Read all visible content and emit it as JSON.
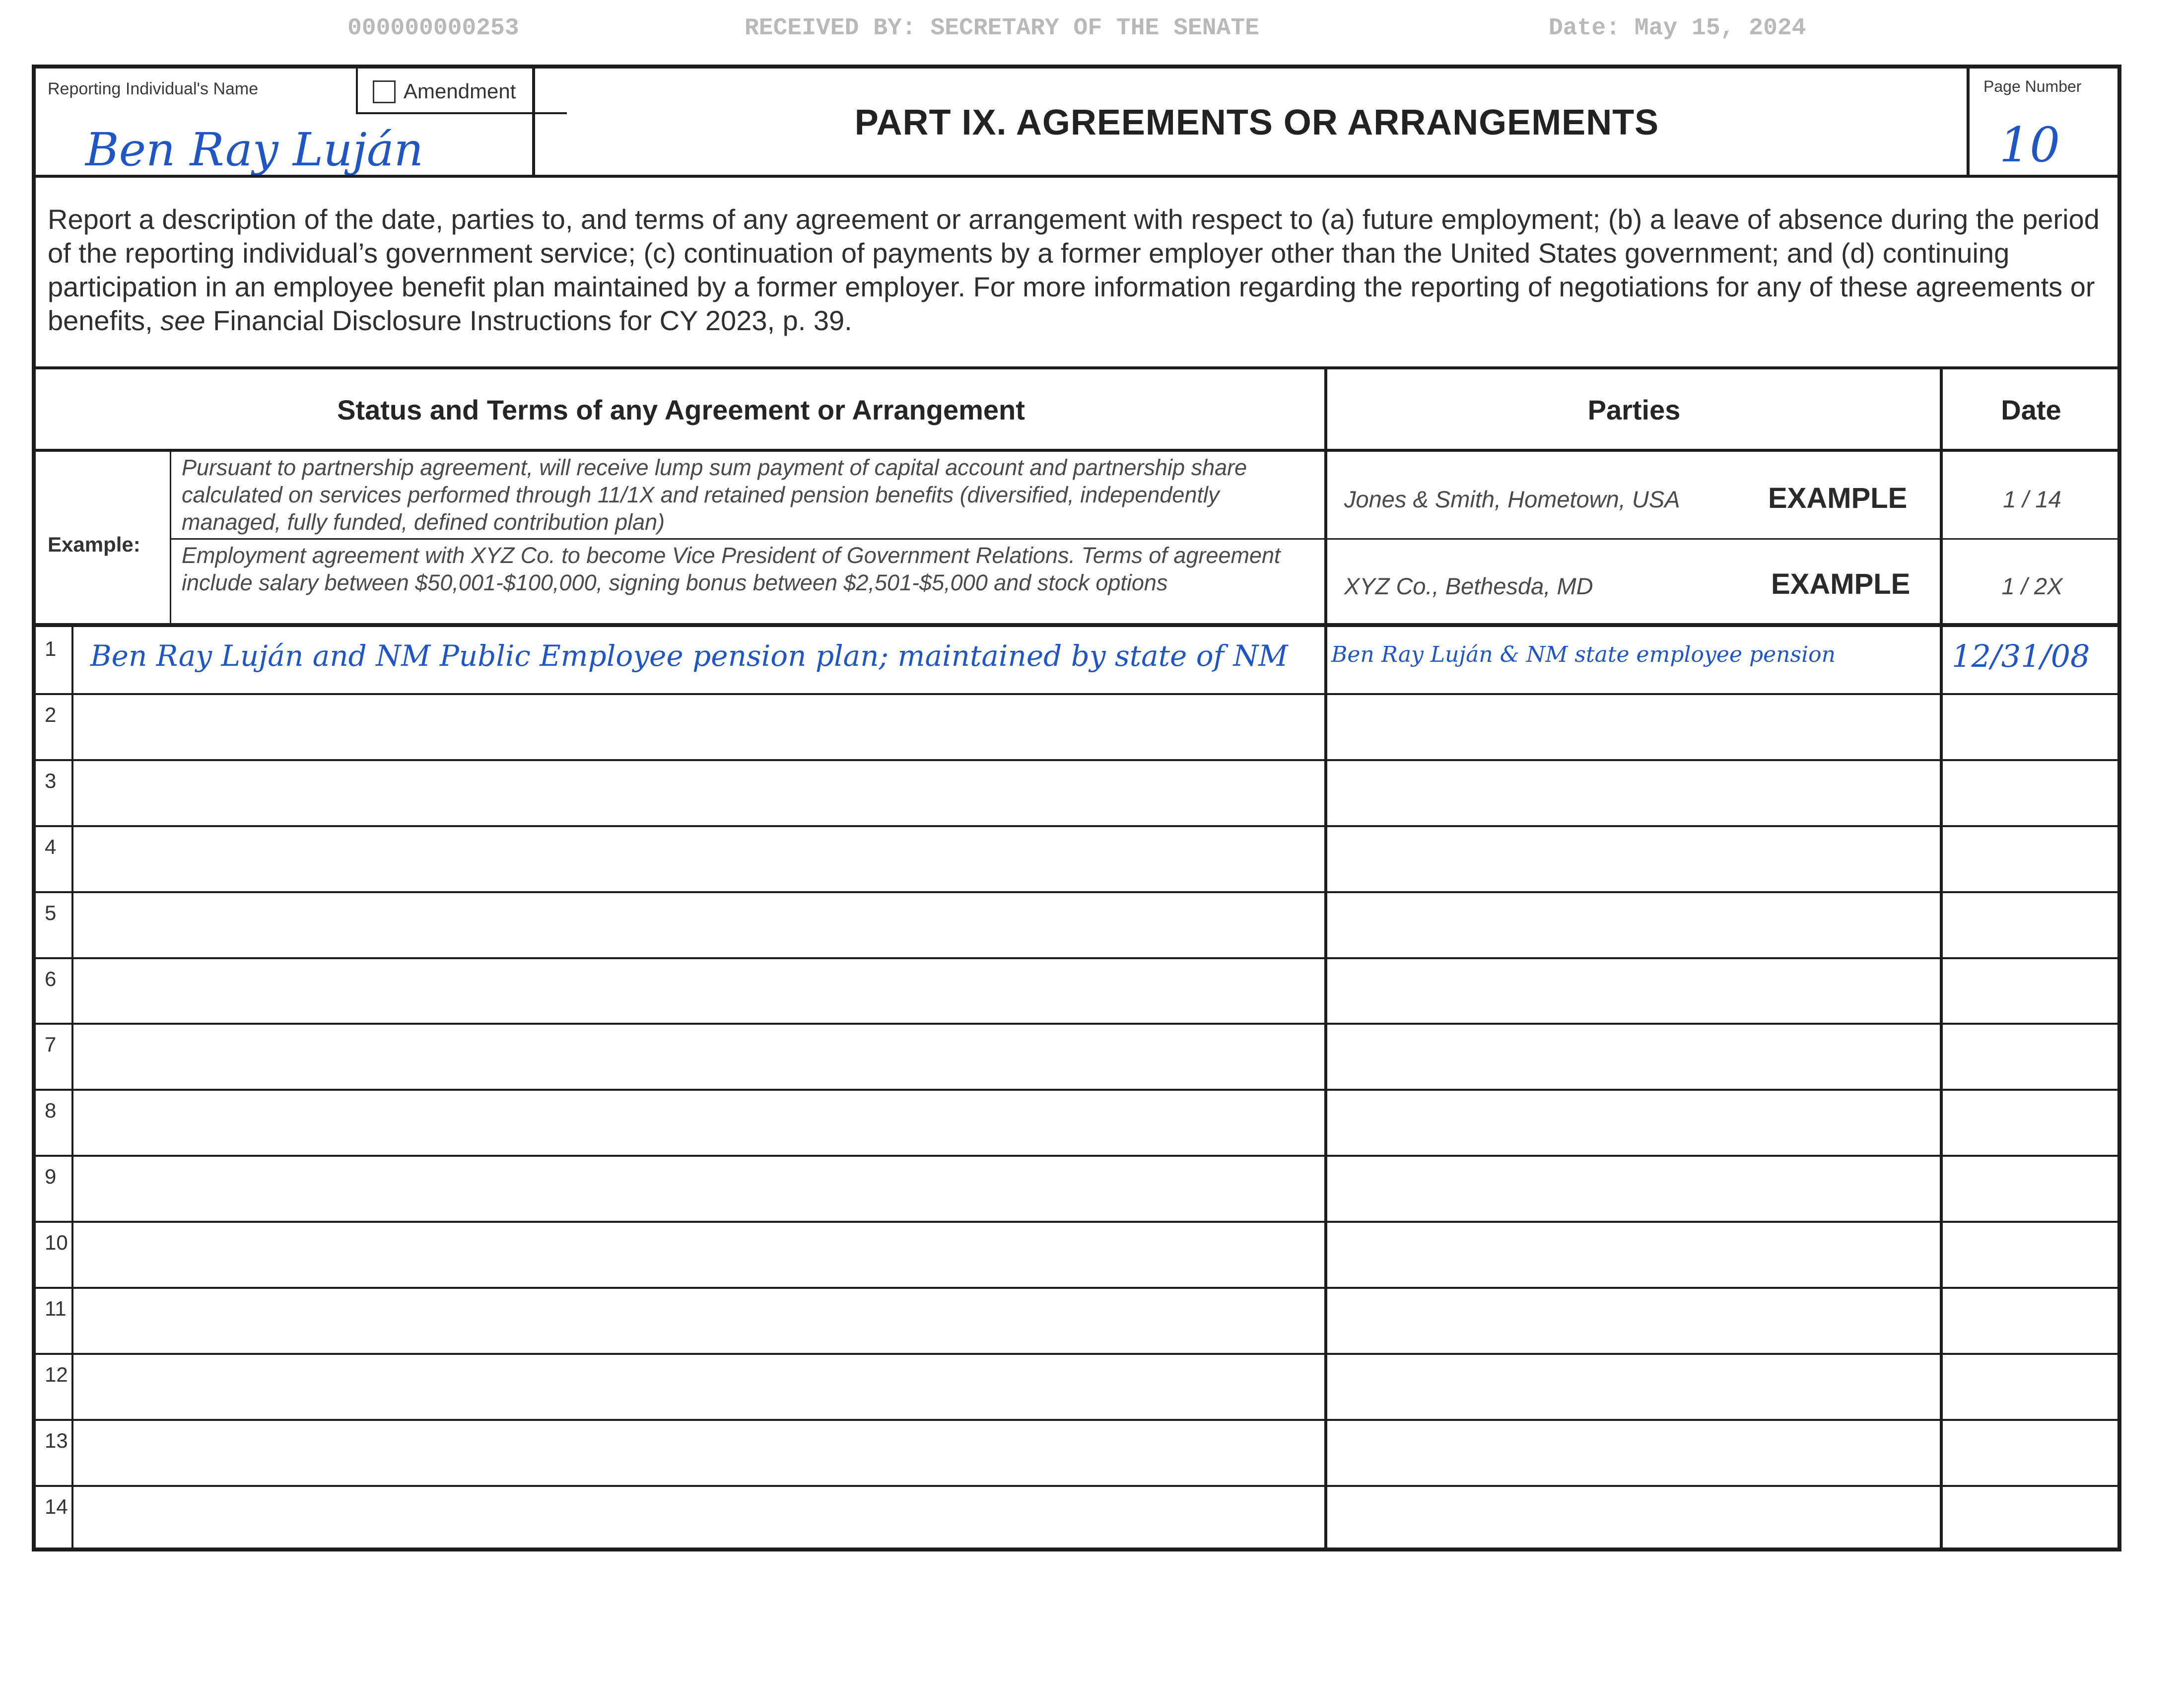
{
  "scan_header": {
    "doc_id": "000000000253",
    "received_by": "RECEIVED BY: SECRETARY OF THE SENATE",
    "date": "Date: May 15, 2024"
  },
  "form": {
    "reporting_name_label": "Reporting Individual's Name",
    "reporting_name_value": "Ben Ray Luján",
    "amendment_label": "Amendment",
    "title": "PART IX.   AGREEMENTS OR ARRANGEMENTS",
    "page_number_label": "Page Number",
    "page_number_value": "10",
    "instructions_pre": "Report a description of the date, parties to, and terms of any agreement or arrangement with respect to (a) future employment; (b) a leave of absence during the period of the reporting individual’s government service; (c) continuation of payments by a former employer other than the United States government; and (d) continuing participation in an employee benefit plan maintained by a former employer.  For more information regarding the reporting of negotiations for any of these agreements or benefits, ",
    "instructions_see": "see",
    "instructions_post": " Financial Disclosure Instructions for CY 2023, p. 39."
  },
  "table": {
    "headers": {
      "terms": "Status and Terms of any Agreement or Arrangement",
      "parties": "Parties",
      "date": "Date"
    },
    "example_label": "Example:",
    "examples": [
      {
        "terms": "Pursuant to partnership agreement, will receive lump sum payment of capital account and partnership share calculated on services performed through 11/1X and retained pension benefits (diversified, independently managed, fully funded, defined contribution plan)",
        "parties": "Jones & Smith, Hometown, USA",
        "tag": "EXAMPLE",
        "date": "1 / 14"
      },
      {
        "terms": "Employment agreement with XYZ Co. to become Vice President of Government Relations.  Terms of agreement include salary between $50,001-$100,000, signing bonus between $2,501-$5,000 and stock options",
        "parties": "XYZ Co., Bethesda, MD",
        "tag": "EXAMPLE",
        "date": "1 / 2X"
      }
    ],
    "rows": [
      {
        "num": "1",
        "terms": "Ben Ray Luján and NM Public Employee pension plan; maintained by state of NM",
        "parties": "Ben Ray Luján & NM state employee pension",
        "date": "12/31/08"
      },
      {
        "num": "2",
        "terms": "",
        "parties": "",
        "date": ""
      },
      {
        "num": "3",
        "terms": "",
        "parties": "",
        "date": ""
      },
      {
        "num": "4",
        "terms": "",
        "parties": "",
        "date": ""
      },
      {
        "num": "5",
        "terms": "",
        "parties": "",
        "date": ""
      },
      {
        "num": "6",
        "terms": "",
        "parties": "",
        "date": ""
      },
      {
        "num": "7",
        "terms": "",
        "parties": "",
        "date": ""
      },
      {
        "num": "8",
        "terms": "",
        "parties": "",
        "date": ""
      },
      {
        "num": "9",
        "terms": "",
        "parties": "",
        "date": ""
      },
      {
        "num": "10",
        "terms": "",
        "parties": "",
        "date": ""
      },
      {
        "num": "11",
        "terms": "",
        "parties": "",
        "date": ""
      },
      {
        "num": "12",
        "terms": "",
        "parties": "",
        "date": ""
      },
      {
        "num": "13",
        "terms": "",
        "parties": "",
        "date": ""
      },
      {
        "num": "14",
        "terms": "",
        "parties": "",
        "date": ""
      }
    ]
  },
  "colors": {
    "ink_blue": "#1f56c4",
    "rule": "#1d1d1d",
    "scan_header_gray": "#b9b9b9"
  }
}
